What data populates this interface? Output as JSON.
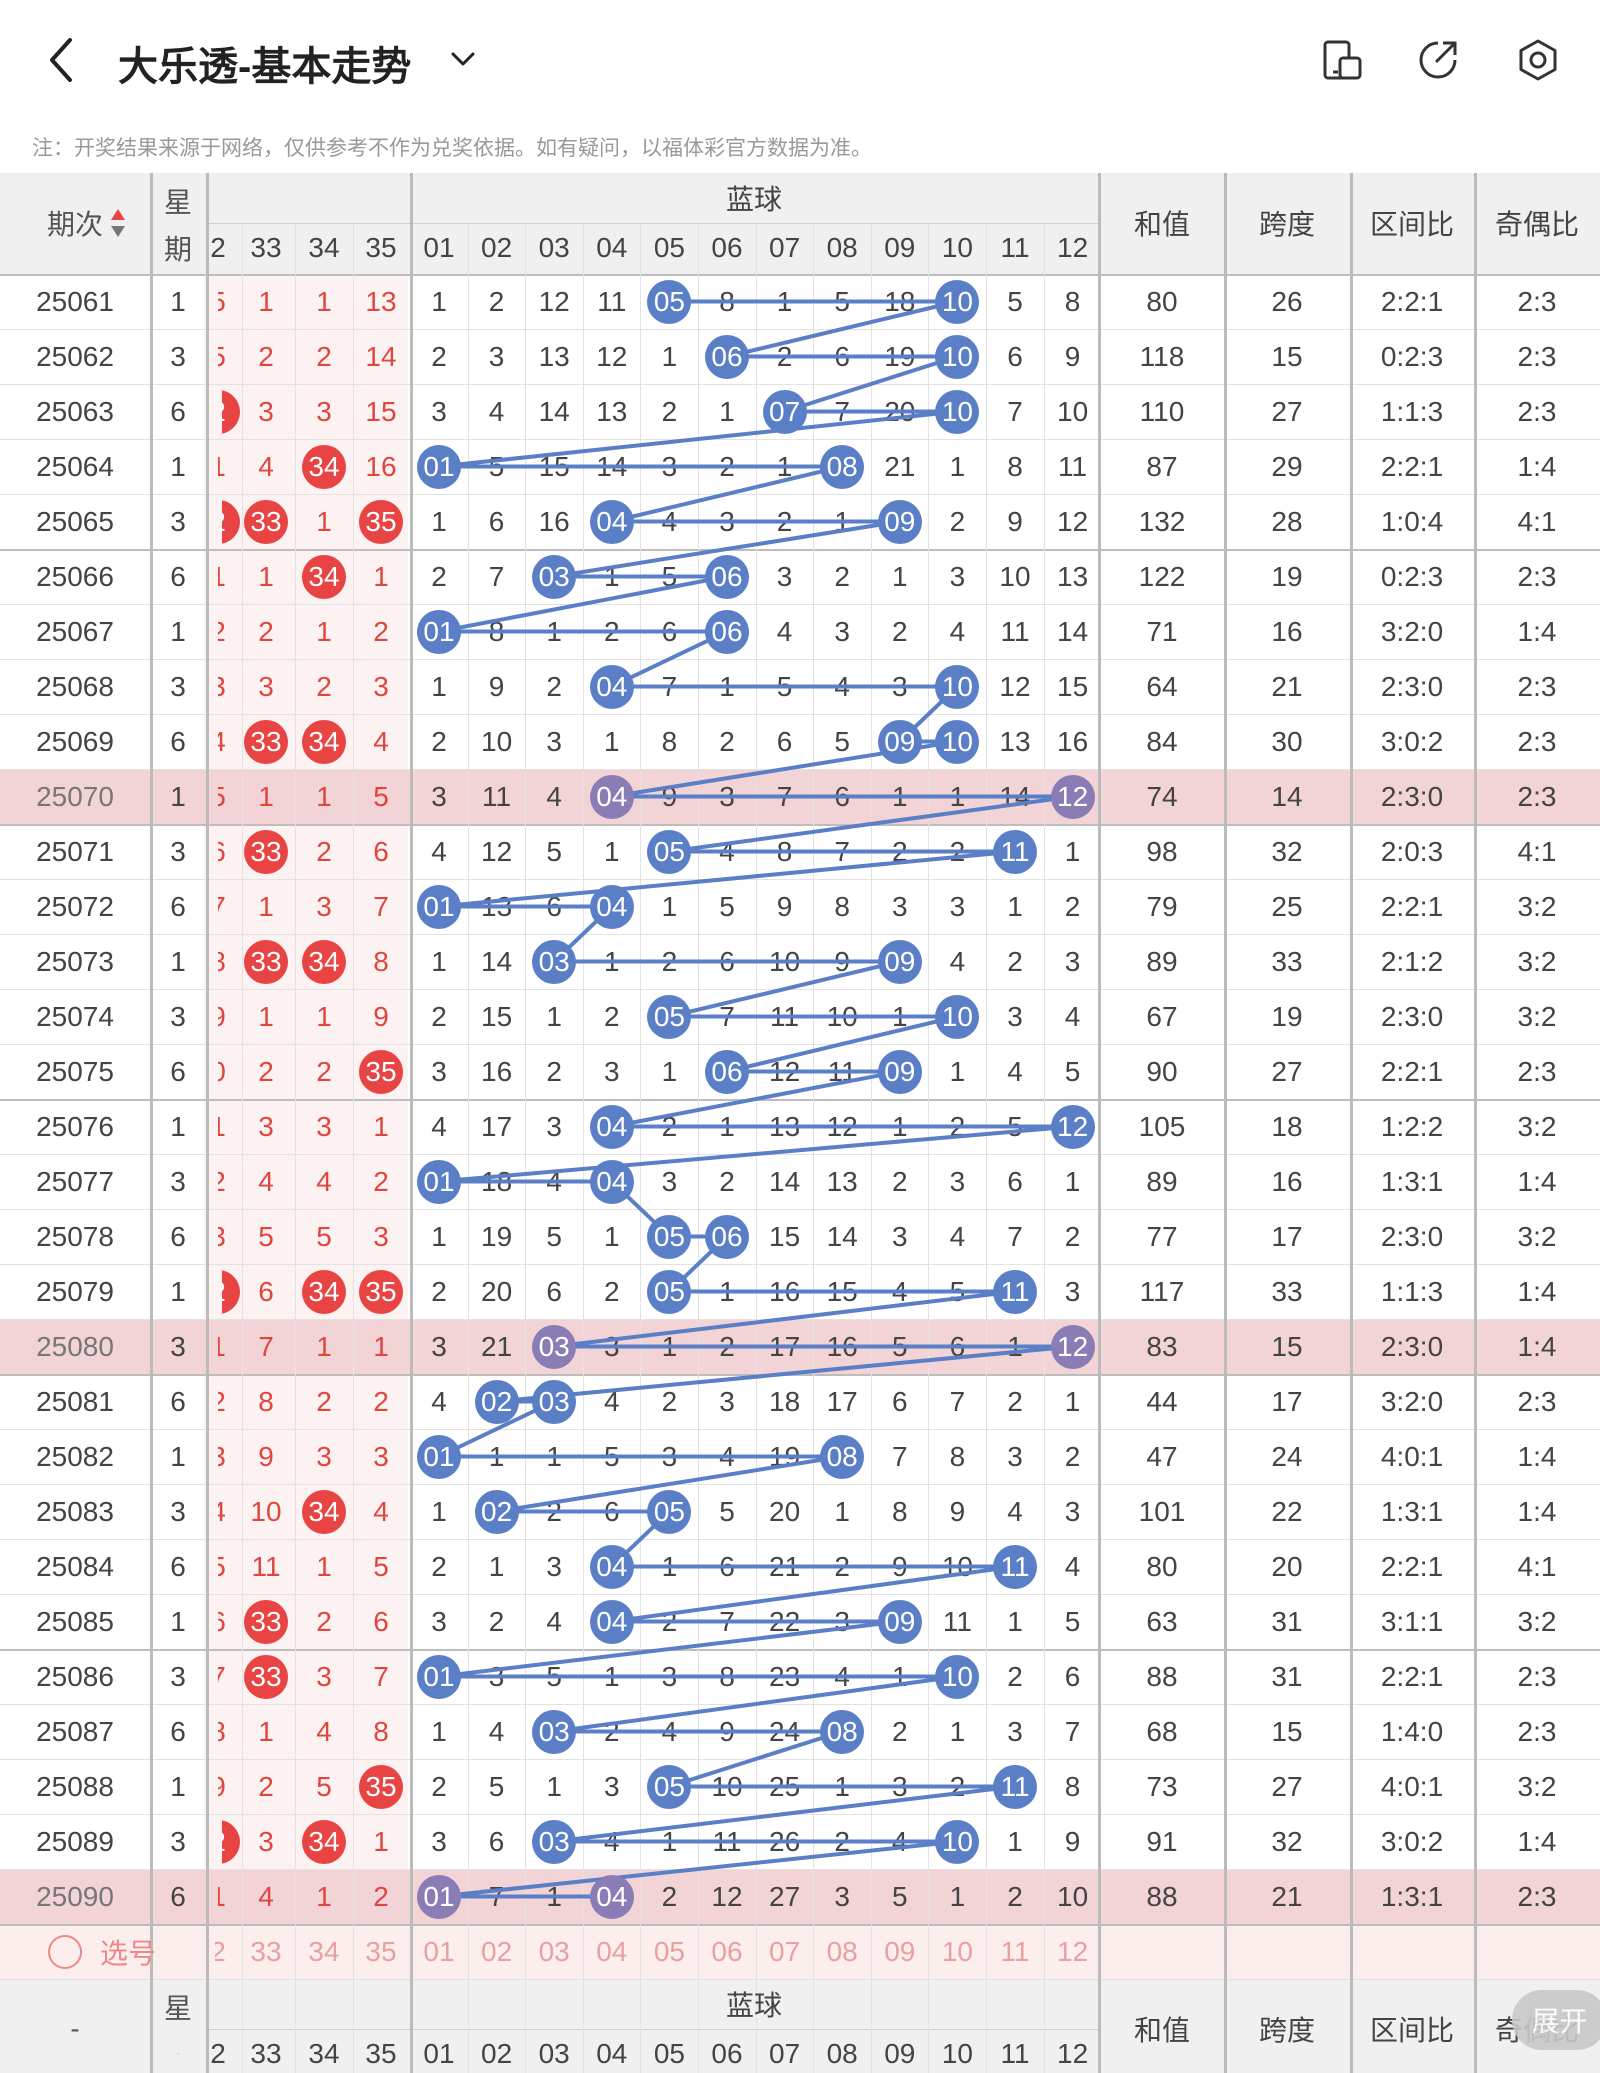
{
  "header": {
    "title": "大乐透-基本走势",
    "icons": [
      "back-icon",
      "chevron-down-icon",
      "device-icon",
      "share-icon",
      "settings-icon"
    ]
  },
  "notice": "注：开奖结果来源于网络，仅供参考不作为兑奖依据。如有疑问，以福体彩官方数据为准。",
  "table": {
    "col_period": "期次",
    "col_week": "星期",
    "blue_group": "蓝球",
    "col_sum": "和值",
    "col_span": "跨度",
    "col_zone": "区间比",
    "col_oddeven": "奇偶比",
    "front_visible_headers": [
      "2",
      "33",
      "34",
      "35"
    ],
    "blue_headers": [
      "01",
      "02",
      "03",
      "04",
      "05",
      "06",
      "07",
      "08",
      "09",
      "10",
      "11",
      "12"
    ],
    "rows": [
      {
        "p": "25061",
        "w": "1",
        "f": [
          "5",
          "1",
          "1",
          "13"
        ],
        "fh": [
          false,
          false,
          false,
          false
        ],
        "b": [
          "1",
          "2",
          "12",
          "11",
          "05",
          "8",
          "1",
          "5",
          "18",
          "10",
          "5",
          "8"
        ],
        "bh": [
          5,
          10
        ],
        "s": "80",
        "sp": "26",
        "z": "2:2:1",
        "oe": "2:3",
        "hl": false
      },
      {
        "p": "25062",
        "w": "3",
        "f": [
          "5",
          "2",
          "2",
          "14"
        ],
        "fh": [
          false,
          false,
          false,
          false
        ],
        "b": [
          "2",
          "3",
          "13",
          "12",
          "1",
          "06",
          "2",
          "6",
          "19",
          "10",
          "6",
          "9"
        ],
        "bh": [
          6,
          10
        ],
        "s": "118",
        "sp": "15",
        "z": "0:2:3",
        "oe": "2:3",
        "hl": false
      },
      {
        "p": "25063",
        "w": "6",
        "f": [
          "2",
          "3",
          "3",
          "15"
        ],
        "fh": [
          true,
          false,
          false,
          false
        ],
        "b": [
          "3",
          "4",
          "14",
          "13",
          "2",
          "1",
          "07",
          "7",
          "20",
          "10",
          "7",
          "10"
        ],
        "bh": [
          7,
          10
        ],
        "s": "110",
        "sp": "27",
        "z": "1:1:3",
        "oe": "2:3",
        "hl": false
      },
      {
        "p": "25064",
        "w": "1",
        "f": [
          "1",
          "4",
          "34",
          "16"
        ],
        "fh": [
          false,
          false,
          true,
          false
        ],
        "b": [
          "01",
          "5",
          "15",
          "14",
          "3",
          "2",
          "1",
          "08",
          "21",
          "1",
          "8",
          "11"
        ],
        "bh": [
          1,
          8
        ],
        "s": "87",
        "sp": "29",
        "z": "2:2:1",
        "oe": "1:4",
        "hl": false
      },
      {
        "p": "25065",
        "w": "3",
        "f": [
          "2",
          "33",
          "1",
          "35"
        ],
        "fh": [
          true,
          true,
          false,
          true
        ],
        "b": [
          "1",
          "6",
          "16",
          "04",
          "4",
          "3",
          "2",
          "1",
          "09",
          "2",
          "9",
          "12"
        ],
        "bh": [
          4,
          9
        ],
        "s": "132",
        "sp": "28",
        "z": "1:0:4",
        "oe": "4:1",
        "hl": false
      },
      {
        "p": "25066",
        "w": "6",
        "f": [
          "1",
          "1",
          "34",
          "1"
        ],
        "fh": [
          false,
          false,
          true,
          false
        ],
        "b": [
          "2",
          "7",
          "03",
          "1",
          "5",
          "06",
          "3",
          "2",
          "1",
          "3",
          "10",
          "13"
        ],
        "bh": [
          3,
          6
        ],
        "s": "122",
        "sp": "19",
        "z": "0:2:3",
        "oe": "2:3",
        "hl": false
      },
      {
        "p": "25067",
        "w": "1",
        "f": [
          "2",
          "2",
          "1",
          "2"
        ],
        "fh": [
          false,
          false,
          false,
          false
        ],
        "b": [
          "01",
          "8",
          "1",
          "2",
          "6",
          "06",
          "4",
          "3",
          "2",
          "4",
          "11",
          "14"
        ],
        "bh": [
          1,
          6
        ],
        "s": "71",
        "sp": "16",
        "z": "3:2:0",
        "oe": "1:4",
        "hl": false
      },
      {
        "p": "25068",
        "w": "3",
        "f": [
          "3",
          "3",
          "2",
          "3"
        ],
        "fh": [
          false,
          false,
          false,
          false
        ],
        "b": [
          "1",
          "9",
          "2",
          "04",
          "7",
          "1",
          "5",
          "4",
          "3",
          "10",
          "12",
          "15"
        ],
        "bh": [
          4,
          10
        ],
        "s": "64",
        "sp": "21",
        "z": "2:3:0",
        "oe": "2:3",
        "hl": false
      },
      {
        "p": "25069",
        "w": "6",
        "f": [
          "4",
          "33",
          "34",
          "4"
        ],
        "fh": [
          false,
          true,
          true,
          false
        ],
        "b": [
          "2",
          "10",
          "3",
          "1",
          "8",
          "2",
          "6",
          "5",
          "09",
          "10",
          "13",
          "16"
        ],
        "bh": [
          9,
          10
        ],
        "s": "84",
        "sp": "30",
        "z": "3:0:2",
        "oe": "2:3",
        "hl": false
      },
      {
        "p": "25070",
        "w": "1",
        "f": [
          "5",
          "1",
          "1",
          "5"
        ],
        "fh": [
          false,
          false,
          false,
          false
        ],
        "b": [
          "3",
          "11",
          "4",
          "04",
          "9",
          "3",
          "7",
          "6",
          "1",
          "1",
          "14",
          "12"
        ],
        "bh": [
          4,
          12
        ],
        "s": "74",
        "sp": "14",
        "z": "2:3:0",
        "oe": "2:3",
        "hl": true
      },
      {
        "p": "25071",
        "w": "3",
        "f": [
          "6",
          "33",
          "2",
          "6"
        ],
        "fh": [
          false,
          true,
          false,
          false
        ],
        "b": [
          "4",
          "12",
          "5",
          "1",
          "05",
          "4",
          "8",
          "7",
          "2",
          "2",
          "11",
          "1"
        ],
        "bh": [
          5,
          11
        ],
        "s": "98",
        "sp": "32",
        "z": "2:0:3",
        "oe": "4:1",
        "hl": false
      },
      {
        "p": "25072",
        "w": "6",
        "f": [
          "7",
          "1",
          "3",
          "7"
        ],
        "fh": [
          false,
          false,
          false,
          false
        ],
        "b": [
          "01",
          "13",
          "6",
          "04",
          "1",
          "5",
          "9",
          "8",
          "3",
          "3",
          "1",
          "2"
        ],
        "bh": [
          1,
          4
        ],
        "s": "79",
        "sp": "25",
        "z": "2:2:1",
        "oe": "3:2",
        "hl": false
      },
      {
        "p": "25073",
        "w": "1",
        "f": [
          "8",
          "33",
          "34",
          "8"
        ],
        "fh": [
          false,
          true,
          true,
          false
        ],
        "b": [
          "1",
          "14",
          "03",
          "1",
          "2",
          "6",
          "10",
          "9",
          "09",
          "4",
          "2",
          "3"
        ],
        "bh": [
          3,
          9
        ],
        "s": "89",
        "sp": "33",
        "z": "2:1:2",
        "oe": "3:2",
        "hl": false
      },
      {
        "p": "25074",
        "w": "3",
        "f": [
          "9",
          "1",
          "1",
          "9"
        ],
        "fh": [
          false,
          false,
          false,
          false
        ],
        "b": [
          "2",
          "15",
          "1",
          "2",
          "05",
          "7",
          "11",
          "10",
          "1",
          "10",
          "3",
          "4"
        ],
        "bh": [
          5,
          10
        ],
        "s": "67",
        "sp": "19",
        "z": "2:3:0",
        "oe": "3:2",
        "hl": false
      },
      {
        "p": "25075",
        "w": "6",
        "f": [
          "0",
          "2",
          "2",
          "35"
        ],
        "fh": [
          false,
          false,
          false,
          true
        ],
        "b": [
          "3",
          "16",
          "2",
          "3",
          "1",
          "06",
          "12",
          "11",
          "09",
          "1",
          "4",
          "5"
        ],
        "bh": [
          6,
          9
        ],
        "s": "90",
        "sp": "27",
        "z": "2:2:1",
        "oe": "2:3",
        "hl": false
      },
      {
        "p": "25076",
        "w": "1",
        "f": [
          "1",
          "3",
          "3",
          "1"
        ],
        "fh": [
          false,
          false,
          false,
          false
        ],
        "b": [
          "4",
          "17",
          "3",
          "04",
          "2",
          "1",
          "13",
          "12",
          "1",
          "2",
          "5",
          "12"
        ],
        "bh": [
          4,
          12
        ],
        "s": "105",
        "sp": "18",
        "z": "1:2:2",
        "oe": "3:2",
        "hl": false
      },
      {
        "p": "25077",
        "w": "3",
        "f": [
          "2",
          "4",
          "4",
          "2"
        ],
        "fh": [
          false,
          false,
          false,
          false
        ],
        "b": [
          "01",
          "18",
          "4",
          "04",
          "3",
          "2",
          "14",
          "13",
          "2",
          "3",
          "6",
          "1"
        ],
        "bh": [
          1,
          4
        ],
        "s": "89",
        "sp": "16",
        "z": "1:3:1",
        "oe": "1:4",
        "hl": false
      },
      {
        "p": "25078",
        "w": "6",
        "f": [
          "3",
          "5",
          "5",
          "3"
        ],
        "fh": [
          false,
          false,
          false,
          false
        ],
        "b": [
          "1",
          "19",
          "5",
          "1",
          "05",
          "06",
          "15",
          "14",
          "3",
          "4",
          "7",
          "2"
        ],
        "bh": [
          5,
          6
        ],
        "s": "77",
        "sp": "17",
        "z": "2:3:0",
        "oe": "3:2",
        "hl": false
      },
      {
        "p": "25079",
        "w": "1",
        "f": [
          "2",
          "6",
          "34",
          "35"
        ],
        "fh": [
          true,
          false,
          true,
          true
        ],
        "b": [
          "2",
          "20",
          "6",
          "2",
          "05",
          "1",
          "16",
          "15",
          "4",
          "5",
          "11",
          "3"
        ],
        "bh": [
          5,
          11
        ],
        "s": "117",
        "sp": "33",
        "z": "1:1:3",
        "oe": "1:4",
        "hl": false
      },
      {
        "p": "25080",
        "w": "3",
        "f": [
          "1",
          "7",
          "1",
          "1"
        ],
        "fh": [
          false,
          false,
          false,
          false
        ],
        "b": [
          "3",
          "21",
          "03",
          "3",
          "1",
          "2",
          "17",
          "16",
          "5",
          "6",
          "1",
          "12"
        ],
        "bh": [
          3,
          12
        ],
        "s": "83",
        "sp": "15",
        "z": "2:3:0",
        "oe": "1:4",
        "hl": true
      },
      {
        "p": "25081",
        "w": "6",
        "f": [
          "2",
          "8",
          "2",
          "2"
        ],
        "fh": [
          false,
          false,
          false,
          false
        ],
        "b": [
          "4",
          "02",
          "03",
          "4",
          "2",
          "3",
          "18",
          "17",
          "6",
          "7",
          "2",
          "1"
        ],
        "bh": [
          2,
          3
        ],
        "s": "44",
        "sp": "17",
        "z": "3:2:0",
        "oe": "2:3",
        "hl": false
      },
      {
        "p": "25082",
        "w": "1",
        "f": [
          "3",
          "9",
          "3",
          "3"
        ],
        "fh": [
          false,
          false,
          false,
          false
        ],
        "b": [
          "01",
          "1",
          "1",
          "5",
          "3",
          "4",
          "19",
          "08",
          "7",
          "8",
          "3",
          "2"
        ],
        "bh": [
          1,
          8
        ],
        "s": "47",
        "sp": "24",
        "z": "4:0:1",
        "oe": "1:4",
        "hl": false
      },
      {
        "p": "25083",
        "w": "3",
        "f": [
          "4",
          "10",
          "34",
          "4"
        ],
        "fh": [
          false,
          false,
          true,
          false
        ],
        "b": [
          "1",
          "02",
          "2",
          "6",
          "05",
          "5",
          "20",
          "1",
          "8",
          "9",
          "4",
          "3"
        ],
        "bh": [
          2,
          5
        ],
        "s": "101",
        "sp": "22",
        "z": "1:3:1",
        "oe": "1:4",
        "hl": false
      },
      {
        "p": "25084",
        "w": "6",
        "f": [
          "5",
          "11",
          "1",
          "5"
        ],
        "fh": [
          false,
          false,
          false,
          false
        ],
        "b": [
          "2",
          "1",
          "3",
          "04",
          "1",
          "6",
          "21",
          "2",
          "9",
          "10",
          "11",
          "4"
        ],
        "bh": [
          4,
          11
        ],
        "s": "80",
        "sp": "20",
        "z": "2:2:1",
        "oe": "4:1",
        "hl": false
      },
      {
        "p": "25085",
        "w": "1",
        "f": [
          "6",
          "33",
          "2",
          "6"
        ],
        "fh": [
          false,
          true,
          false,
          false
        ],
        "b": [
          "3",
          "2",
          "4",
          "04",
          "2",
          "7",
          "22",
          "3",
          "09",
          "11",
          "1",
          "5"
        ],
        "bh": [
          4,
          9
        ],
        "s": "63",
        "sp": "31",
        "z": "3:1:1",
        "oe": "3:2",
        "hl": false
      },
      {
        "p": "25086",
        "w": "3",
        "f": [
          "7",
          "33",
          "3",
          "7"
        ],
        "fh": [
          false,
          true,
          false,
          false
        ],
        "b": [
          "01",
          "3",
          "5",
          "1",
          "3",
          "8",
          "23",
          "4",
          "1",
          "10",
          "2",
          "6"
        ],
        "bh": [
          1,
          10
        ],
        "s": "88",
        "sp": "31",
        "z": "2:2:1",
        "oe": "2:3",
        "hl": false
      },
      {
        "p": "25087",
        "w": "6",
        "f": [
          "8",
          "1",
          "4",
          "8"
        ],
        "fh": [
          false,
          false,
          false,
          false
        ],
        "b": [
          "1",
          "4",
          "03",
          "2",
          "4",
          "9",
          "24",
          "08",
          "2",
          "1",
          "3",
          "7"
        ],
        "bh": [
          3,
          8
        ],
        "s": "68",
        "sp": "15",
        "z": "1:4:0",
        "oe": "2:3",
        "hl": false
      },
      {
        "p": "25088",
        "w": "1",
        "f": [
          "9",
          "2",
          "5",
          "35"
        ],
        "fh": [
          false,
          false,
          false,
          true
        ],
        "b": [
          "2",
          "5",
          "1",
          "3",
          "05",
          "10",
          "25",
          "1",
          "3",
          "2",
          "11",
          "8"
        ],
        "bh": [
          5,
          11
        ],
        "s": "73",
        "sp": "27",
        "z": "4:0:1",
        "oe": "3:2",
        "hl": false
      },
      {
        "p": "25089",
        "w": "3",
        "f": [
          "2",
          "3",
          "34",
          "1"
        ],
        "fh": [
          true,
          false,
          true,
          false
        ],
        "b": [
          "3",
          "6",
          "03",
          "4",
          "1",
          "11",
          "26",
          "2",
          "4",
          "10",
          "1",
          "9"
        ],
        "bh": [
          3,
          10
        ],
        "s": "91",
        "sp": "32",
        "z": "3:0:2",
        "oe": "1:4",
        "hl": false
      },
      {
        "p": "25090",
        "w": "6",
        "f": [
          "1",
          "4",
          "1",
          "2"
        ],
        "fh": [
          false,
          false,
          false,
          false
        ],
        "b": [
          "01",
          "7",
          "1",
          "04",
          "2",
          "12",
          "27",
          "3",
          "5",
          "1",
          "2",
          "10"
        ],
        "bh": [
          1,
          4
        ],
        "s": "88",
        "sp": "21",
        "z": "1:3:1",
        "oe": "2:3",
        "hl": true
      }
    ],
    "select_label": "选号",
    "select_front": [
      "2",
      "33",
      "34",
      "35"
    ],
    "select_blue": [
      "01",
      "02",
      "03",
      "04",
      "05",
      "06",
      "07",
      "08",
      "09",
      "10",
      "11",
      "12"
    ],
    "footer_period": "-",
    "expand_label": "展开"
  },
  "colors": {
    "blue_ball": "#5b7fc7",
    "blue_ball_highlight": "#8a7cb5",
    "red_ball": "#e84444",
    "line": "#5b7fc7",
    "highlight_row": "#f2d3d6",
    "header_bg": "#f0f0f0",
    "front_text": "#e0463f"
  }
}
